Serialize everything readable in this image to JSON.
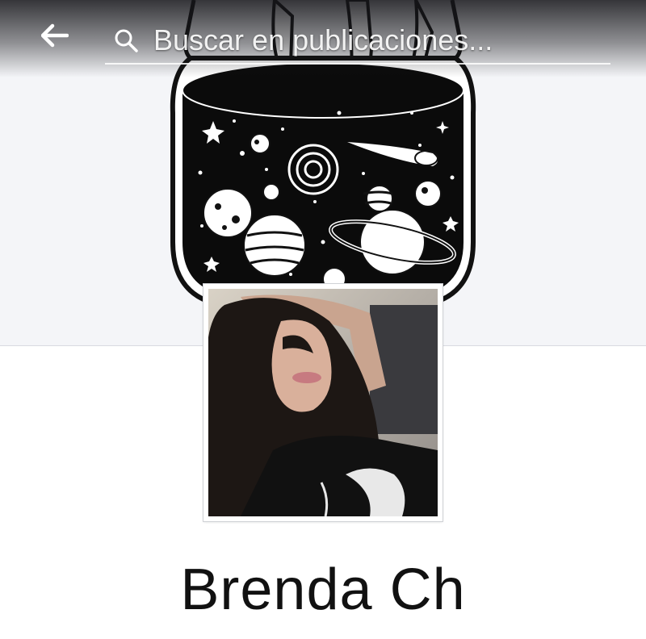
{
  "header": {
    "search_placeholder": "Buscar en publicaciones...",
    "back_icon": "arrow-left-icon",
    "search_icon": "magnifier-icon"
  },
  "cover": {
    "description_icon": "galaxy-jar-illustration"
  },
  "profile": {
    "name": "Brenda Ch"
  },
  "colors": {
    "background": "#ffffff",
    "cover_background": "#f4f5f8",
    "header_overlay": "#141418",
    "text": "#111111"
  }
}
